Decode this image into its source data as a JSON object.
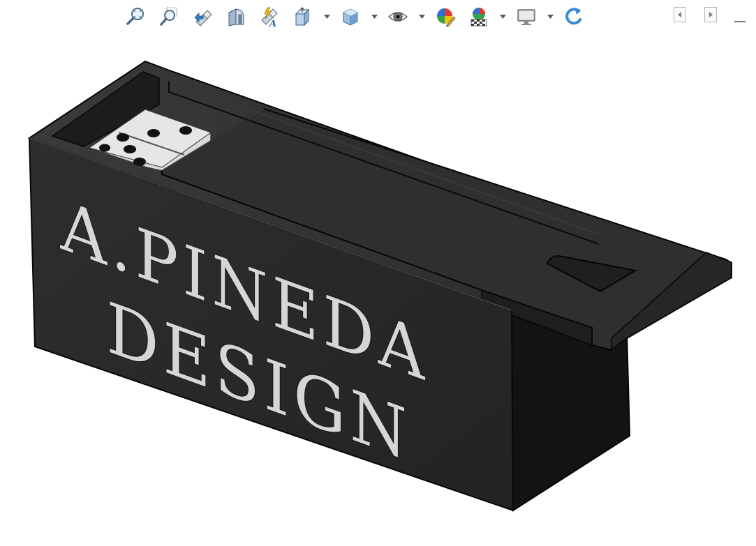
{
  "toolbar": {
    "items": [
      {
        "name": "zoom-to-fit-icon",
        "type": "button"
      },
      {
        "name": "zoom-to-area-icon",
        "type": "button"
      },
      {
        "name": "previous-view-icon",
        "type": "button"
      },
      {
        "name": "section-view-icon",
        "type": "button"
      },
      {
        "name": "dynamic-annotation-view-icon",
        "type": "button"
      },
      {
        "name": "view-orientation-icon",
        "type": "button",
        "dropdown": true
      },
      {
        "name": "display-style-icon",
        "type": "button",
        "dropdown": true
      },
      {
        "name": "hide-show-items-icon",
        "type": "button",
        "dropdown": true
      },
      {
        "name": "edit-appearance-icon",
        "type": "button"
      },
      {
        "name": "apply-scene-icon",
        "type": "button",
        "dropdown": true
      },
      {
        "name": "view-settings-icon",
        "type": "button",
        "dropdown": true
      },
      {
        "name": "rotate-view-icon",
        "type": "button"
      }
    ]
  },
  "window_controls": {
    "items": [
      "restore-left-icon",
      "restore-right-icon",
      "minimize-icon"
    ]
  },
  "model": {
    "engraving_line_1": "A.PINEDA",
    "engraving_line_2": "DESIGN",
    "colors": {
      "box_body": "#2a2a2a",
      "box_shadow": "#151515",
      "box_top": "#333333",
      "edge": "#050505",
      "domino": "#d9d9d9",
      "engraving": "#d6d6d6",
      "background": "#ffffff"
    }
  }
}
